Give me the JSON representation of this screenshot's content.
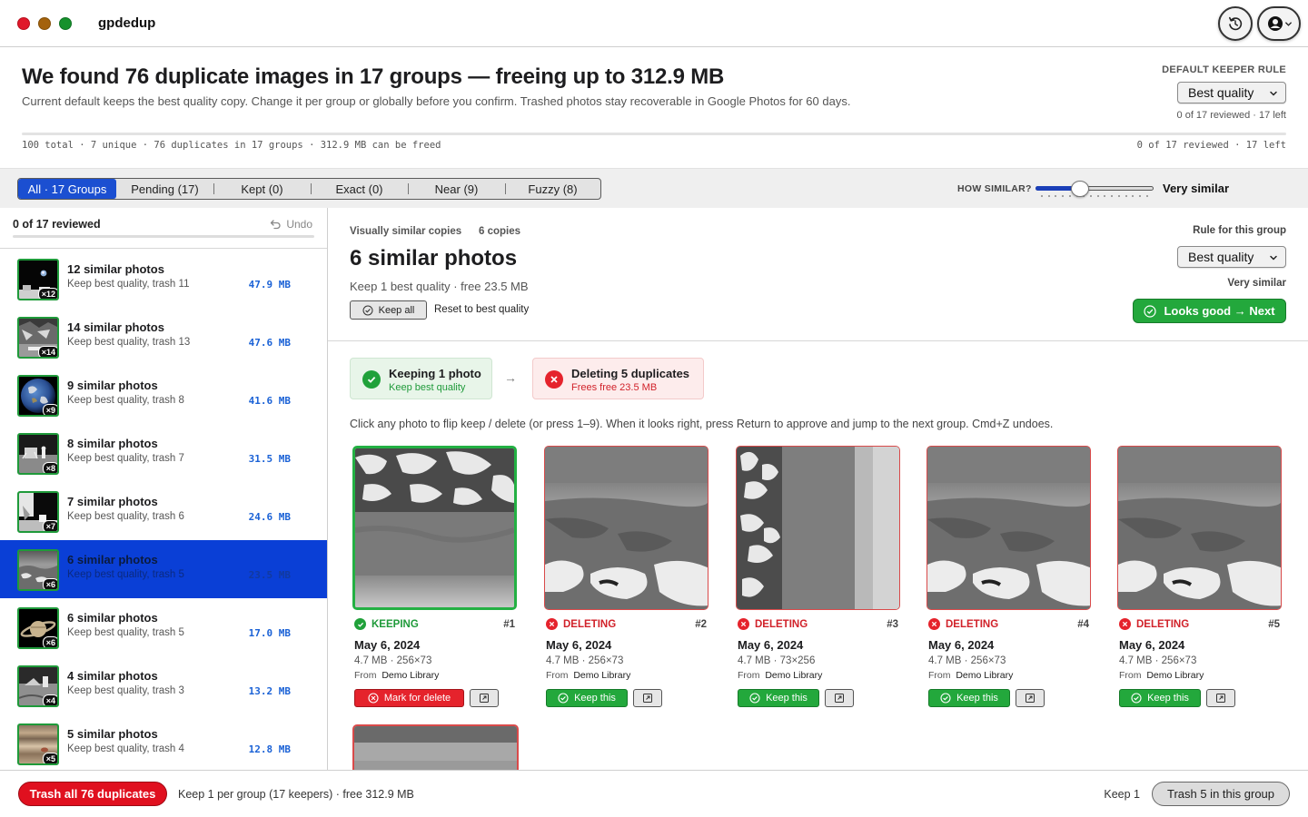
{
  "app": {
    "title": "gpdedup"
  },
  "summary": {
    "headline": "We found 76 duplicate images in 17 groups — freeing up to 312.9 MB",
    "subtitle": "Current default keeps the best quality copy. Change it per group or globally before you confirm. Trashed photos stay recoverable in Google Photos for 60 days.",
    "default_rule_label": "DEFAULT KEEPER RULE",
    "default_rule_value": "Best quality",
    "reviewed": "0 of 17 reviewed · 17 left",
    "stats": "100 total · 7 unique · 76 duplicates in 17 groups · 312.9 MB can be freed",
    "stats_right": "0 of 17 reviewed · 17 left"
  },
  "filters": {
    "tabs": [
      {
        "label": "All · 17 Groups",
        "active": true
      },
      {
        "label": "Pending (17)"
      },
      {
        "label": "Kept (0)"
      },
      {
        "label": "Exact (0)"
      },
      {
        "label": "Near (9)"
      },
      {
        "label": "Fuzzy (8)"
      }
    ],
    "similarity_label": "HOW SIMILAR?",
    "similarity_value": "Very similar",
    "similarity_level": 0.35
  },
  "sidebar": {
    "reviewed": "0 of 17 reviewed",
    "undo": "Undo",
    "groups": [
      {
        "title": "12 similar photos",
        "sub": "Keep best quality, trash 11",
        "size": "47.9 MB",
        "badge": "×12"
      },
      {
        "title": "14 similar photos",
        "sub": "Keep best quality, trash 13",
        "size": "47.6 MB",
        "badge": "×14"
      },
      {
        "title": "9 similar photos",
        "sub": "Keep best quality, trash 8",
        "size": "41.6 MB",
        "badge": "×9"
      },
      {
        "title": "8 similar photos",
        "sub": "Keep best quality, trash 7",
        "size": "31.5 MB",
        "badge": "×8"
      },
      {
        "title": "7 similar photos",
        "sub": "Keep best quality, trash 6",
        "size": "24.6 MB",
        "badge": "×7"
      },
      {
        "title": "6 similar photos",
        "sub": "Keep best quality, trash 5",
        "size": "23.5 MB",
        "badge": "×6",
        "selected": true
      },
      {
        "title": "6 similar photos",
        "sub": "Keep best quality, trash 5",
        "size": "17.0 MB",
        "badge": "×6"
      },
      {
        "title": "4 similar photos",
        "sub": "Keep best quality, trash 3",
        "size": "13.2 MB",
        "badge": "×4"
      },
      {
        "title": "5 similar photos",
        "sub": "Keep best quality, trash 4",
        "size": "12.8 MB",
        "badge": "×5"
      }
    ]
  },
  "group": {
    "kind": "Visually similar copies",
    "copies": "6 copies",
    "title": "6 similar photos",
    "subtitle": "Keep 1 best quality · free 23.5 MB",
    "keep_all": "Keep all",
    "reset": "Reset to best quality",
    "rule_label": "Rule for this group",
    "rule_value": "Best quality",
    "similarity": "Very similar",
    "next": "Looks good → Next",
    "keep_summary_title": "Keeping 1 photo",
    "keep_summary_sub": "Keep best quality",
    "delete_summary_title": "Deleting 5 duplicates",
    "delete_summary_sub": "Frees free 23.5 MB",
    "hint": "Click any photo to flip keep / delete (or press 1–9). When it looks right, press Return to approve and jump to the next group. Cmd+Z undoes.",
    "photos": [
      {
        "status": "KEEPING",
        "index": "#1",
        "date": "May 6, 2024",
        "meta": "4.7 MB · 256×73",
        "from_label": "From",
        "from": "Demo Library",
        "action": "Mark for delete"
      },
      {
        "status": "DELETING",
        "index": "#2",
        "date": "May 6, 2024",
        "meta": "4.7 MB · 256×73",
        "from_label": "From",
        "from": "Demo Library",
        "action": "Keep this"
      },
      {
        "status": "DELETING",
        "index": "#3",
        "date": "May 6, 2024",
        "meta": "4.7 MB · 73×256",
        "from_label": "From",
        "from": "Demo Library",
        "action": "Keep this"
      },
      {
        "status": "DELETING",
        "index": "#4",
        "date": "May 6, 2024",
        "meta": "4.7 MB · 256×73",
        "from_label": "From",
        "from": "Demo Library",
        "action": "Keep this"
      },
      {
        "status": "DELETING",
        "index": "#5",
        "date": "May 6, 2024",
        "meta": "4.7 MB · 256×73",
        "from_label": "From",
        "from": "Demo Library",
        "action": "Keep this"
      }
    ]
  },
  "footer": {
    "trash_all": "Trash all 76 duplicates",
    "summary": "Keep 1 per group (17 keepers) · free 312.9 MB",
    "keep_one": "Keep 1",
    "trash_group": "Trash 5 in this group"
  },
  "colors": {
    "accent": "#1b4fd1",
    "keep": "#23a83c",
    "delete": "#e5232c"
  }
}
